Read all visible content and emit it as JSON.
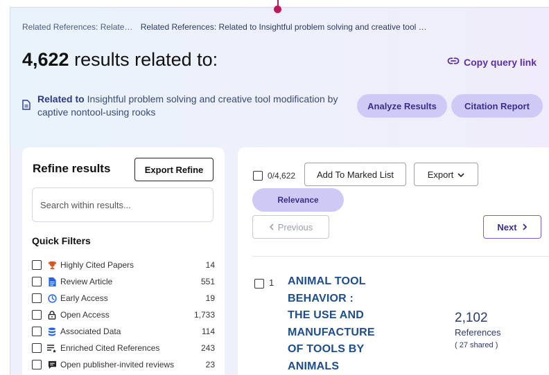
{
  "breadcrumb": {
    "link": "Related References: Relate…",
    "current": "Related References: Related to Insightful problem solving and creative tool …"
  },
  "results": {
    "count": "4,622",
    "suffix": " results related to:",
    "copy_link": "Copy query link"
  },
  "related": {
    "prefix": "Related to",
    "text": " Insightful problem solving and creative tool modification by captive nontool-using rooks"
  },
  "actions": {
    "analyze": "Analyze Results",
    "citation": "Citation Report"
  },
  "refine": {
    "title": "Refine results",
    "export": "Export Refine",
    "search_placeholder": "Search within results...",
    "quick_filters_title": "Quick Filters",
    "quick_filters": [
      {
        "label": "Highly Cited Papers",
        "count": "14",
        "icon": "trophy-icon",
        "color": "#d9541e"
      },
      {
        "label": "Review Article",
        "count": "551",
        "icon": "document-icon",
        "color": "#2563eb"
      },
      {
        "label": "Early Access",
        "count": "19",
        "icon": "clock-icon",
        "color": "#2563eb"
      },
      {
        "label": "Open Access",
        "count": "1,733",
        "icon": "lock-open-icon",
        "color": "#222222"
      },
      {
        "label": "Associated Data",
        "count": "114",
        "icon": "database-icon",
        "color": "#2563eb"
      },
      {
        "label": "Enriched Cited References",
        "count": "243",
        "icon": "list-star-icon",
        "color": "#222222"
      },
      {
        "label": "Open publisher-invited reviews",
        "count": "23",
        "icon": "comment-icon",
        "color": "#222222"
      }
    ]
  },
  "list": {
    "selected": "0/4,622",
    "add_marked": "Add To Marked List",
    "export": "Export",
    "sort": "Relevance",
    "previous": "Previous",
    "next": "Next"
  },
  "record": {
    "number": "1",
    "title_lines": [
      "ANIMAL TOOL",
      "BEHAVIOR :",
      "THE USE AND",
      "MANUFACTURE",
      "OF TOOLS BY",
      "ANIMALS"
    ],
    "references": "2,102",
    "references_label": "References",
    "shared": "( 27 shared )"
  },
  "colors": {
    "accent": "#5b2fa8",
    "pill": "#cfc9f5",
    "title_link": "#1e4d8c",
    "pin": "#c2185b"
  }
}
